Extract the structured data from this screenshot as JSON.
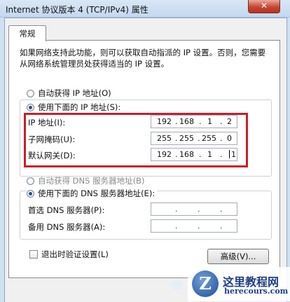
{
  "window": {
    "title": "Internet 协议版本 4 (TCP/IPv4) 属性",
    "close_glyph": "✕"
  },
  "tabs": [
    {
      "label": "常规"
    }
  ],
  "description": "如果网络支持此功能，则可以获取自动指派的 IP 设置。否则，您需要从网络系统管理员处获得适当的 IP 设置。",
  "ip_section": {
    "auto_label": "自动获得 IP 地址(O)",
    "manual_label": "使用下面的 IP 地址(S):",
    "fields": [
      {
        "label": "IP 地址(I):",
        "octets": [
          "192",
          "168",
          "1",
          "2"
        ]
      },
      {
        "label": "子网掩码(U):",
        "octets": [
          "255",
          "255",
          "255",
          "0"
        ]
      },
      {
        "label": "默认网关(D):",
        "octets": [
          "192",
          "168",
          "1",
          "1"
        ]
      }
    ]
  },
  "dns_section": {
    "auto_label": "自动获得 DNS 服务器地址(B)",
    "manual_label": "使用下面的 DNS 服务器地址(E):",
    "fields": [
      {
        "label": "首选 DNS 服务器(P):"
      },
      {
        "label": "备用 DNS 服务器(A):"
      }
    ]
  },
  "validate_on_exit_label": "退出时验证设置(L)",
  "advanced_button": "高级(V)...",
  "watermark": {
    "logo_letter": "Z",
    "site_name": "这里教程网",
    "url": "herecours.com"
  },
  "colors": {
    "highlight": "#c8202a",
    "watermark_blue": "#1e3f8a"
  }
}
